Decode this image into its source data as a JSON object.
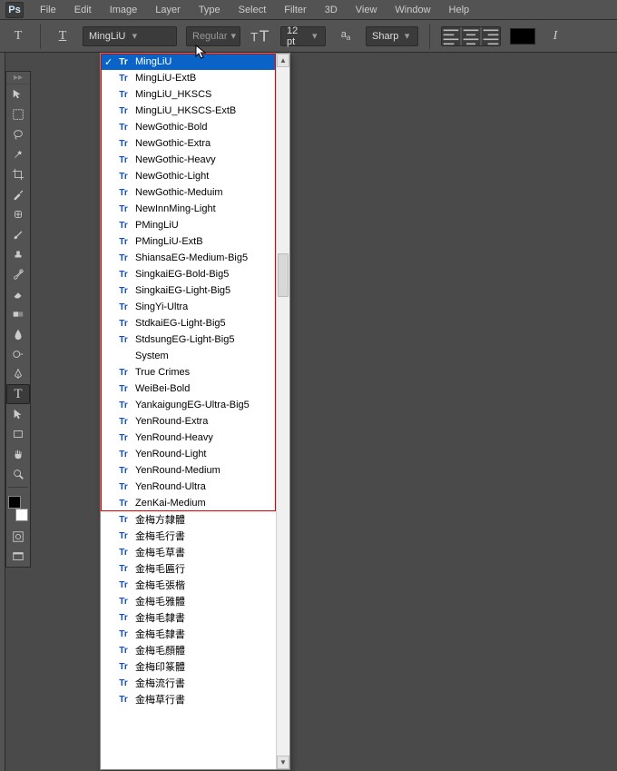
{
  "menu": {
    "items": [
      "File",
      "Edit",
      "Image",
      "Layer",
      "Type",
      "Select",
      "Filter",
      "3D",
      "View",
      "Window",
      "Help"
    ]
  },
  "options": {
    "font_family": "MingLiU",
    "font_style": "Regular",
    "font_size": "12 pt",
    "antialias": "Sharp"
  },
  "fonts": [
    "MingLiU",
    "MingLiU-ExtB",
    "MingLiU_HKSCS",
    "MingLiU_HKSCS-ExtB",
    "NewGothic-Bold",
    "NewGothic-Extra",
    "NewGothic-Heavy",
    "NewGothic-Light",
    "NewGothic-Meduim",
    "NewInnMing-Light",
    "PMingLiU",
    "PMingLiU-ExtB",
    "ShiansaEG-Medium-Big5",
    "SingkaiEG-Bold-Big5",
    "SingkaiEG-Light-Big5",
    "SingYi-Ultra",
    "StdkaiEG-Light-Big5",
    "StdsungEG-Light-Big5",
    "System",
    "True Crimes",
    "WeiBei-Bold",
    "YankaigungEG-Ultra-Big5",
    "YenRound-Extra",
    "YenRound-Heavy",
    "YenRound-Light",
    "YenRound-Medium",
    "YenRound-Ultra",
    "ZenKai-Medium",
    "金梅方隸體",
    "金梅毛行書",
    "金梅毛草書",
    "金梅毛匾行",
    "金梅毛張楷",
    "金梅毛雅體",
    "金梅毛隸書",
    "金梅毛隸書",
    "金梅毛顏體",
    "金梅印篆體",
    "金梅流行書",
    "金梅草行書"
  ],
  "selected_font_index": 0,
  "redbox_end_index": 28
}
